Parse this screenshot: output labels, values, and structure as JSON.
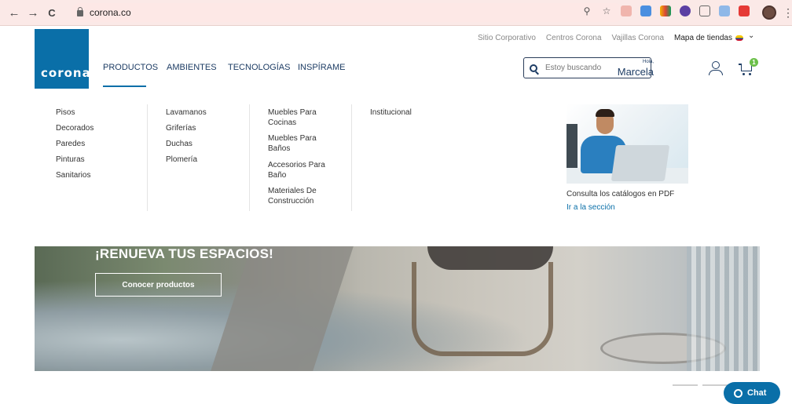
{
  "browser": {
    "url": "corona.co",
    "back_glyph": "←",
    "forward_glyph": "→",
    "reload_glyph": "C",
    "zoom_glyph": "⚲",
    "star_glyph": "☆",
    "menu_glyph": "⋮"
  },
  "header": {
    "logo_text": "corona",
    "top_links": [
      "Sitio Corporativo",
      "Centros Corona",
      "Vajillas Corona",
      "Mapa de tiendas"
    ],
    "flag_caret": "⌄",
    "nav": [
      "PRODUCTOS",
      "AMBIENTES",
      "TECNOLOGÍAS",
      "INSPÍRAME"
    ],
    "search_placeholder": "Estoy buscando",
    "user_greeting": "Hola,",
    "user_name": "Marcela",
    "cart_count": "1"
  },
  "dropdown": {
    "col1": [
      "Pisos",
      "Decorados",
      "Paredes",
      "Pinturas",
      "Sanitarios"
    ],
    "col2": [
      "Lavamanos",
      "Griferías",
      "Duchas",
      "Plomería"
    ],
    "col3": [
      "Muebles Para Cocinas",
      "Muebles Para Baños",
      "Accesorios Para Baño",
      "Materiales De Construcción"
    ],
    "col4": [
      "Institucional"
    ],
    "promo_text": "Consulta los catálogos en PDF",
    "promo_link": "Ir a la sección"
  },
  "hero": {
    "title": "¡RENUEVA TUS ESPACIOS!",
    "button": "Conocer productos"
  },
  "chat": {
    "label": "Chat"
  },
  "colors": {
    "brand": "#0a6fa8",
    "nav_text": "#1d3c64",
    "browser_bar": "#fbe9e7",
    "cart_badge": "#6cc04a"
  }
}
